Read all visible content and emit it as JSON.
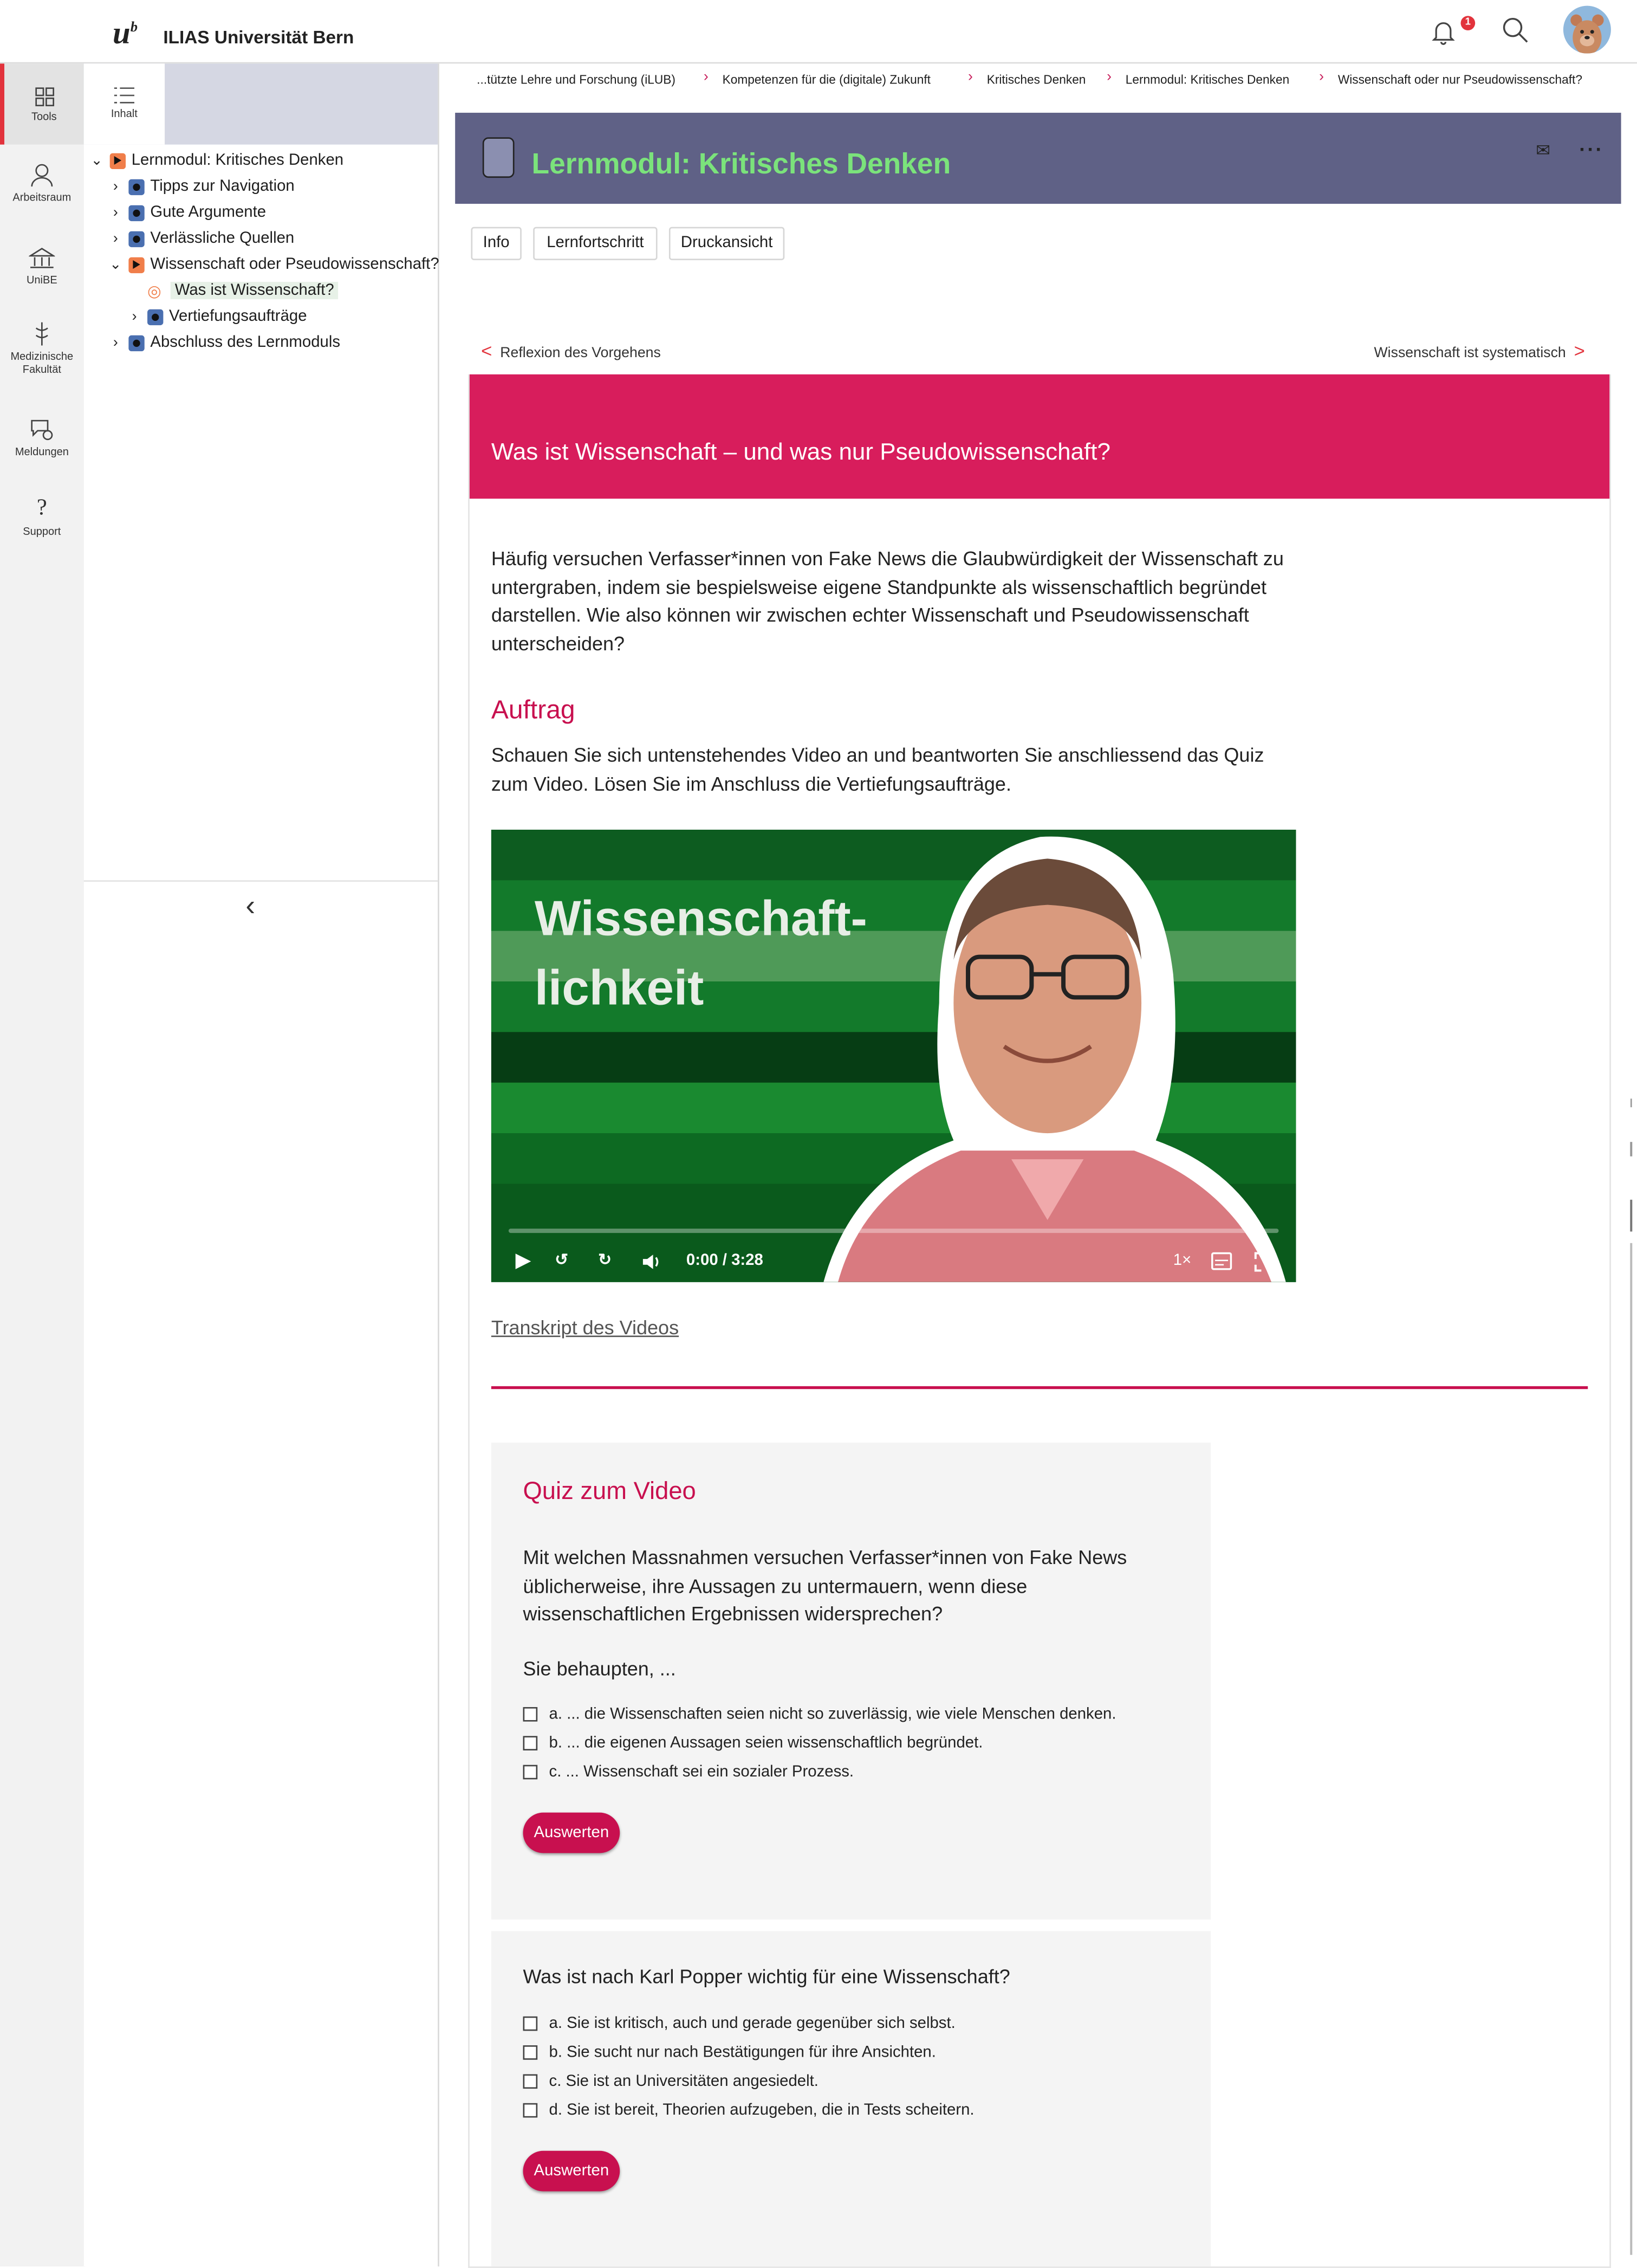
{
  "header": {
    "logo_mark": "u",
    "logo_sup": "b",
    "org_name": "ILIAS Universität Bern",
    "notification_count": "1"
  },
  "rail": {
    "items": [
      {
        "label": "Tools"
      },
      {
        "label": "Arbeitsraum"
      },
      {
        "label": "UniBE"
      },
      {
        "label": "Medizinische Fakultät"
      },
      {
        "label": "Meldungen"
      },
      {
        "label": "Support"
      }
    ]
  },
  "tree": {
    "tab_label": "Inhalt",
    "nodes": [
      {
        "label": "Lernmodul: Kritisches Denken"
      },
      {
        "label": "Tipps zur Navigation"
      },
      {
        "label": "Gute Argumente"
      },
      {
        "label": "Verlässliche Quellen"
      },
      {
        "label": "Wissenschaft oder Pseudowissenschaft?"
      },
      {
        "label": "Was ist Wissenschaft?"
      },
      {
        "label": "Vertiefungsaufträge"
      },
      {
        "label": "Abschluss des Lernmoduls"
      }
    ]
  },
  "breadcrumbs": [
    "...tützte Lehre und Forschung (iLUB)",
    "Kompetenzen für die (digitale) Zukunft",
    "Kritisches Denken",
    "Lernmodul: Kritisches Denken",
    "Wissenschaft oder nur Pseudowissenschaft?"
  ],
  "object": {
    "title": "Lernmodul: Kritisches Denken",
    "tabs": [
      "Info",
      "Lernfortschritt",
      "Druckansicht"
    ]
  },
  "pagenav": {
    "prev": "Reflexion des Vorgehens",
    "next": "Wissenschaft ist systematisch"
  },
  "page": {
    "title": "Was ist Wissenschaft – und was nur Pseudowissenschaft?",
    "intro": "Häufig versuchen Verfasser*innen von Fake News die Glaubwürdigkeit der Wissenschaft zu untergraben, indem sie bespielsweise eigene Standpunkte als wissenschaftlich begründet darstellen. Wie also können wir zwischen echter Wissenschaft und Pseudowissenschaft unterscheiden?",
    "task_heading": "Auftrag",
    "task_text": "Schauen Sie sich untenstehendes Video an und beantworten Sie anschliessend das Quiz zum Video. Lösen Sie im Anschluss die Vertiefungsaufträge.",
    "video": {
      "title_line1": "Wissenschaft-",
      "title_line2": "lichkeit",
      "time": "0:00 / 3:28",
      "speed": "1×",
      "progress": 0
    },
    "transcript_link": "Transkript des Videos"
  },
  "quiz1": {
    "heading": "Quiz zum Video",
    "question": "Mit welchen Massnahmen versuchen Verfasser*innen von Fake News üblicherweise, ihre Aussagen zu untermauern, wenn diese wissenschaftlichen Ergebnissen widersprechen?",
    "lead": "Sie behaupten, ...",
    "options": [
      "a. ... die Wissenschaften seien nicht so zuverlässig, wie viele Menschen denken.",
      "b. ... die eigenen Aussagen seien wissenschaftlich begründet.",
      "c. ... Wissenschaft sei ein sozialer Prozess."
    ],
    "button": "Auswerten"
  },
  "quiz2": {
    "question": "Was ist nach Karl Popper wichtig für eine Wissenschaft?",
    "options": [
      "a. Sie ist kritisch, auch und gerade gegenüber sich selbst.",
      "b. Sie sucht nur nach Bestätigungen für ihre Ansichten.",
      "c. Sie ist an Universitäten angesiedelt.",
      "d. Sie ist bereit, Theorien aufzugeben, die in Tests scheitern."
    ],
    "button": "Auswerten"
  },
  "colors": {
    "accent": "#c8104f",
    "banner": "#d81d5c",
    "header_card": "#5f6186",
    "title_green": "#7be37b"
  }
}
